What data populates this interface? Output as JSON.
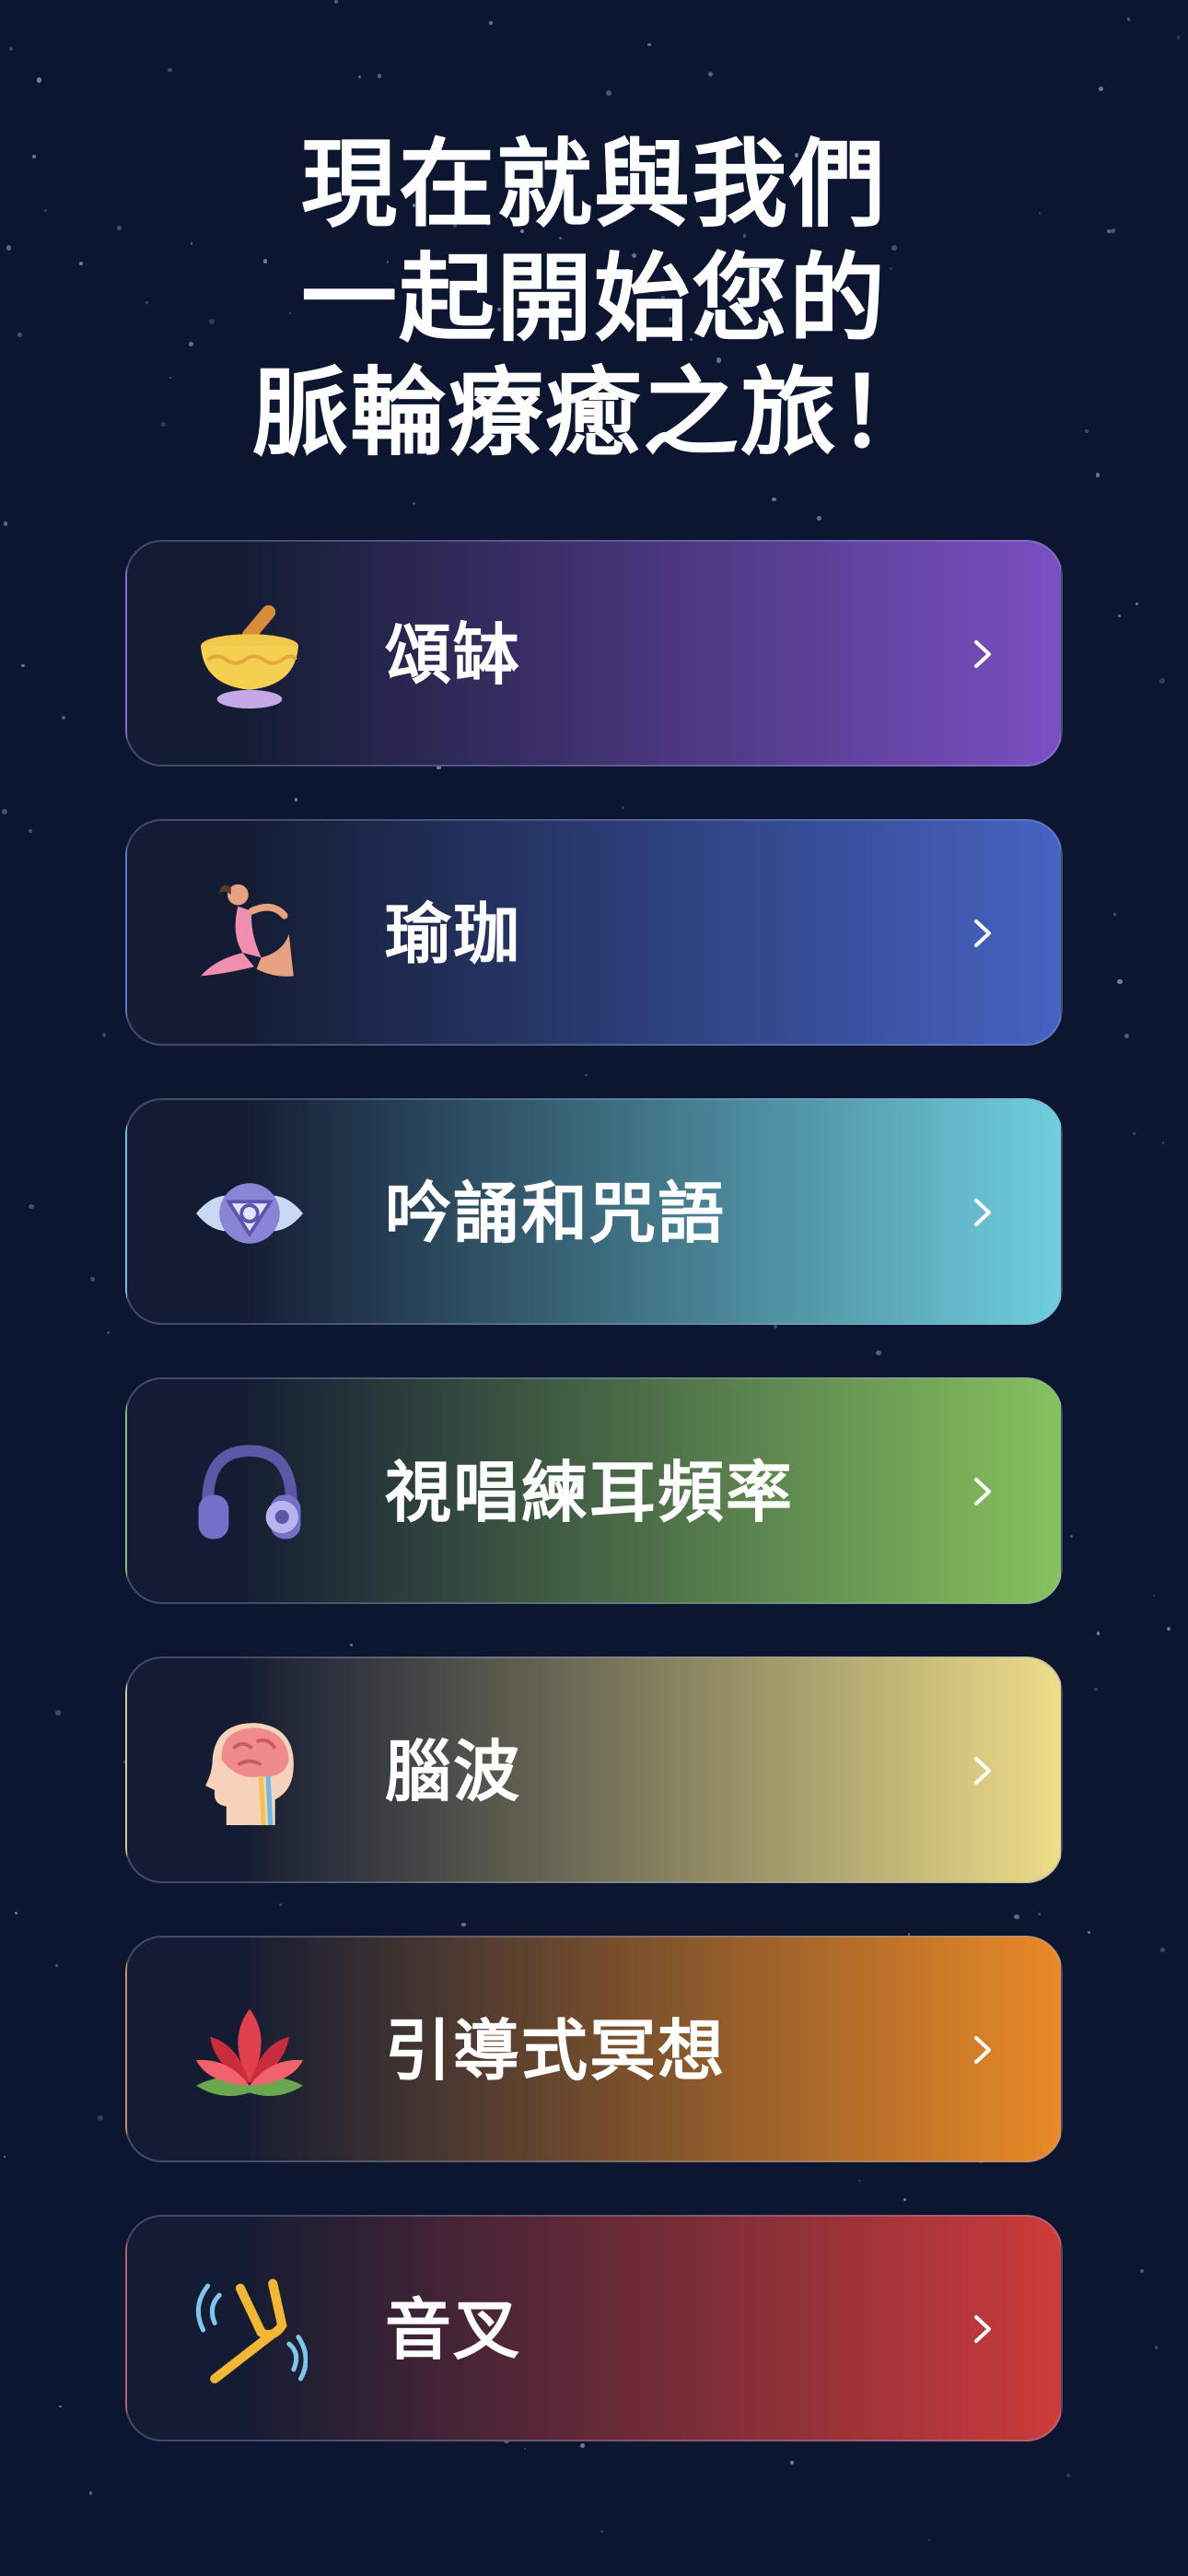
{
  "title_lines": [
    "現在就與我們",
    "一起開始您的",
    "脈輪療癒之旅！"
  ],
  "categories": [
    {
      "label": "頌缽",
      "icon": "singing-bowl-icon",
      "gradient_end": "#7b4fc2"
    },
    {
      "label": "瑜珈",
      "icon": "yoga-pose-icon",
      "gradient_end": "#4563c2"
    },
    {
      "label": "吟誦和咒語",
      "icon": "third-eye-icon",
      "gradient_end": "#6fcfdd"
    },
    {
      "label": "視唱練耳頻率",
      "icon": "headphones-icon",
      "gradient_end": "#86c25e"
    },
    {
      "label": "腦波",
      "icon": "brain-head-icon",
      "gradient_end": "#eedd88"
    },
    {
      "label": "引導式冥想",
      "icon": "lotus-icon",
      "gradient_end": "#ea8a26"
    },
    {
      "label": "音叉",
      "icon": "tuning-fork-icon",
      "gradient_end": "#cd3b3b"
    }
  ],
  "colors": {
    "background": "#0d1631",
    "card_start": "#141c33"
  }
}
